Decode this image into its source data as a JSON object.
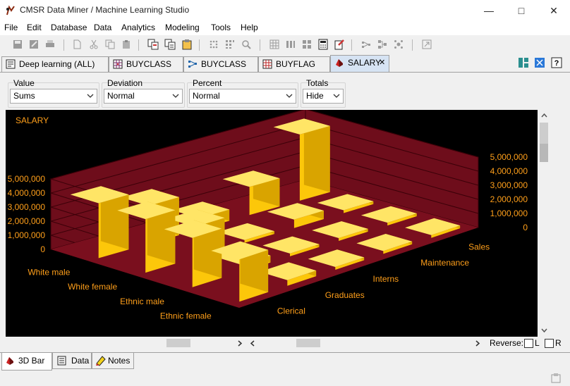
{
  "window": {
    "title": "CMSR Data Miner / Machine Learning Studio"
  },
  "menu": [
    "File",
    "Edit",
    "Database",
    "Data",
    "Analytics",
    "Modeling",
    "Tools",
    "Help"
  ],
  "tabs": [
    {
      "label": "Deep learning (ALL)",
      "icon": "document-icon"
    },
    {
      "label": "BUYCLASS",
      "icon": "grid-icon"
    },
    {
      "label": "BUYCLASS",
      "icon": "network-icon"
    },
    {
      "label": "BUYFLAG",
      "icon": "tree-icon"
    },
    {
      "label": "SALARY",
      "icon": "3d-bar-icon",
      "selected": true
    }
  ],
  "controls": {
    "value": {
      "label": "Value",
      "selected": "Sums"
    },
    "deviation": {
      "label": "Deviation",
      "selected": "Normal"
    },
    "percent": {
      "label": "Percent",
      "selected": "Normal"
    },
    "totals": {
      "label": "Totals",
      "selected": "Hide"
    }
  },
  "chart_data": {
    "type": "bar3d",
    "title": "SALARY",
    "rows": [
      "White male",
      "White female",
      "Ethnic male",
      "Ethnic female"
    ],
    "columns": [
      "Clerical",
      "Graduates",
      "Interns",
      "Maintenance",
      "Sales"
    ],
    "left_axis_ticks": [
      "5,000,000",
      "4,000,000",
      "3,000,000",
      "2,000,000",
      "1,000,000",
      "0"
    ],
    "right_axis_ticks": [
      "5,000,000",
      "4,000,000",
      "3,000,000",
      "2,000,000",
      "1,000,000",
      "0"
    ],
    "zlim": [
      0,
      5000000
    ],
    "values": [
      [
        3900000,
        2700000,
        800000,
        2000000,
        4700000
      ],
      [
        3800000,
        2200000,
        200000,
        600000,
        200000
      ],
      [
        3500000,
        500000,
        200000,
        200000,
        200000
      ],
      [
        3000000,
        400000,
        200000,
        200000,
        200000
      ]
    ],
    "colors": {
      "background": "#000000",
      "floor": "#7a0f1e",
      "wall": "#6e0d1b",
      "bar_top": "#ffe566",
      "bar_front": "#fcc70a",
      "bar_side": "#d9a400",
      "text": "#ff9f1a"
    }
  },
  "bottom_tabs": [
    {
      "label": "3D Bar",
      "icon": "3d-bar-icon",
      "selected": true
    },
    {
      "label": "Data",
      "icon": "data-icon"
    },
    {
      "label": "Notes",
      "icon": "notes-icon"
    }
  ],
  "reverse": {
    "label": "Reverse:",
    "l_label": "L",
    "r_label": "R"
  }
}
